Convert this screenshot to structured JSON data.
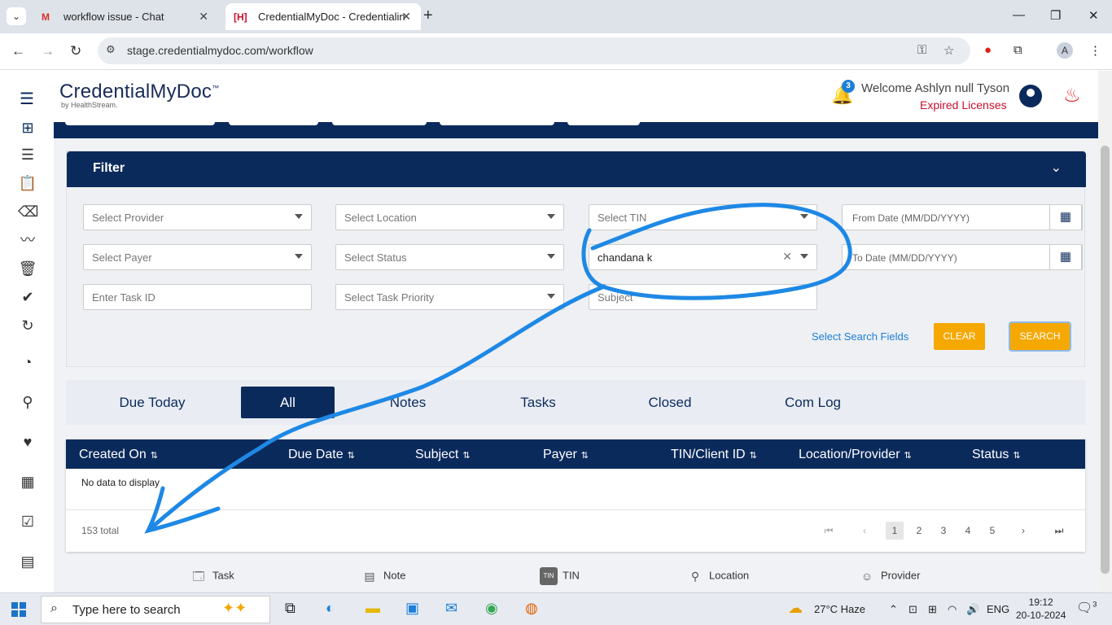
{
  "browser": {
    "tabs": [
      {
        "title": "workflow issue - Chat",
        "active": false
      },
      {
        "title": "CredentialMyDoc - Credentialin",
        "active": true
      }
    ],
    "url": "stage.credentialmydoc.com/workflow",
    "profile_initial": "A"
  },
  "header": {
    "logo": "CredentialMyDoc",
    "logo_tm": "™",
    "logo_sub": "by HealthStream.",
    "notification_count": "3",
    "welcome": "Welcome Ashlyn null Tyson",
    "expired": "Expired Licenses"
  },
  "filter": {
    "title": "Filter",
    "provider_placeholder": "Select Provider",
    "location_placeholder": "Select Location",
    "tin_placeholder": "Select TIN",
    "from_date_placeholder": "From Date (MM/DD/YYYY)",
    "payer_placeholder": "Select Payer",
    "status_placeholder": "Select Status",
    "assignee_value": "chandana k",
    "to_date_placeholder": "To Date (MM/DD/YYYY)",
    "task_id_placeholder": "Enter Task ID",
    "priority_placeholder": "Select Task Priority",
    "subject_placeholder": "Subject",
    "select_fields_link": "Select Search Fields",
    "clear_label": "CLEAR",
    "search_label": "SEARCH"
  },
  "workflow_tabs": [
    "Due Today",
    "All",
    "Notes",
    "Tasks",
    "Closed",
    "Com Log"
  ],
  "active_tab": "All",
  "table": {
    "columns": [
      "Created On",
      "Due Date",
      "Subject",
      "Payer",
      "TIN/Client ID",
      "Location/Provider",
      "Status"
    ],
    "empty_text": "No data to display",
    "total": "153 total",
    "pages": [
      "1",
      "2",
      "3",
      "4",
      "5"
    ],
    "current_page": "1"
  },
  "legend": [
    "Task",
    "Note",
    "TIN",
    "Location",
    "Provider"
  ],
  "taskbar": {
    "search_placeholder": "Type here to search",
    "weather": "27°C  Haze",
    "lang": "ENG",
    "time": "19:12",
    "date": "20-10-2024",
    "notif_count": "3"
  },
  "colors": {
    "navy": "#0b2a5c",
    "orange": "#f5a800",
    "link": "#1a7fd8",
    "annotation": "#1e88e5"
  }
}
